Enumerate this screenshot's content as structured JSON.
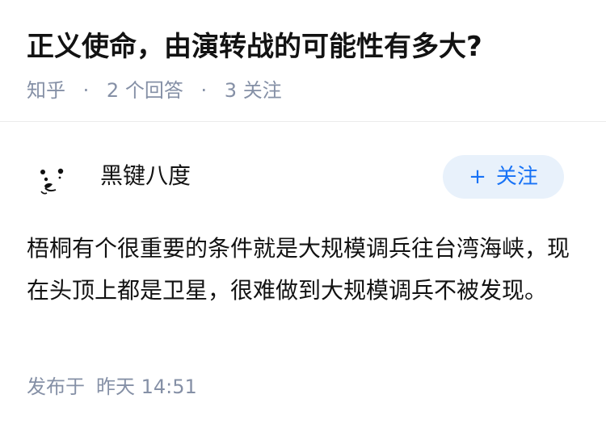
{
  "question": {
    "title": "正义使命，由演转战的可能性有多大?",
    "source": "知乎",
    "separator": "·",
    "answers_count": "2",
    "answers_label": "个回答",
    "follows_count": "3",
    "follows_label": "关注"
  },
  "author": {
    "name": "黑键八度",
    "avatar_icon": "dog-face-icon",
    "follow_plus": "+",
    "follow_label": "关注",
    "accent_color": "#1772f6",
    "follow_bg": "#e8f1fb"
  },
  "answer": {
    "content": "梧桐有个很重要的条件就是大规模调兵往台湾海峡，现在头顶上都是卫星，很难做到大规模调兵不被发现。",
    "published_label": "发布于",
    "published_time": "昨天 14:51"
  }
}
